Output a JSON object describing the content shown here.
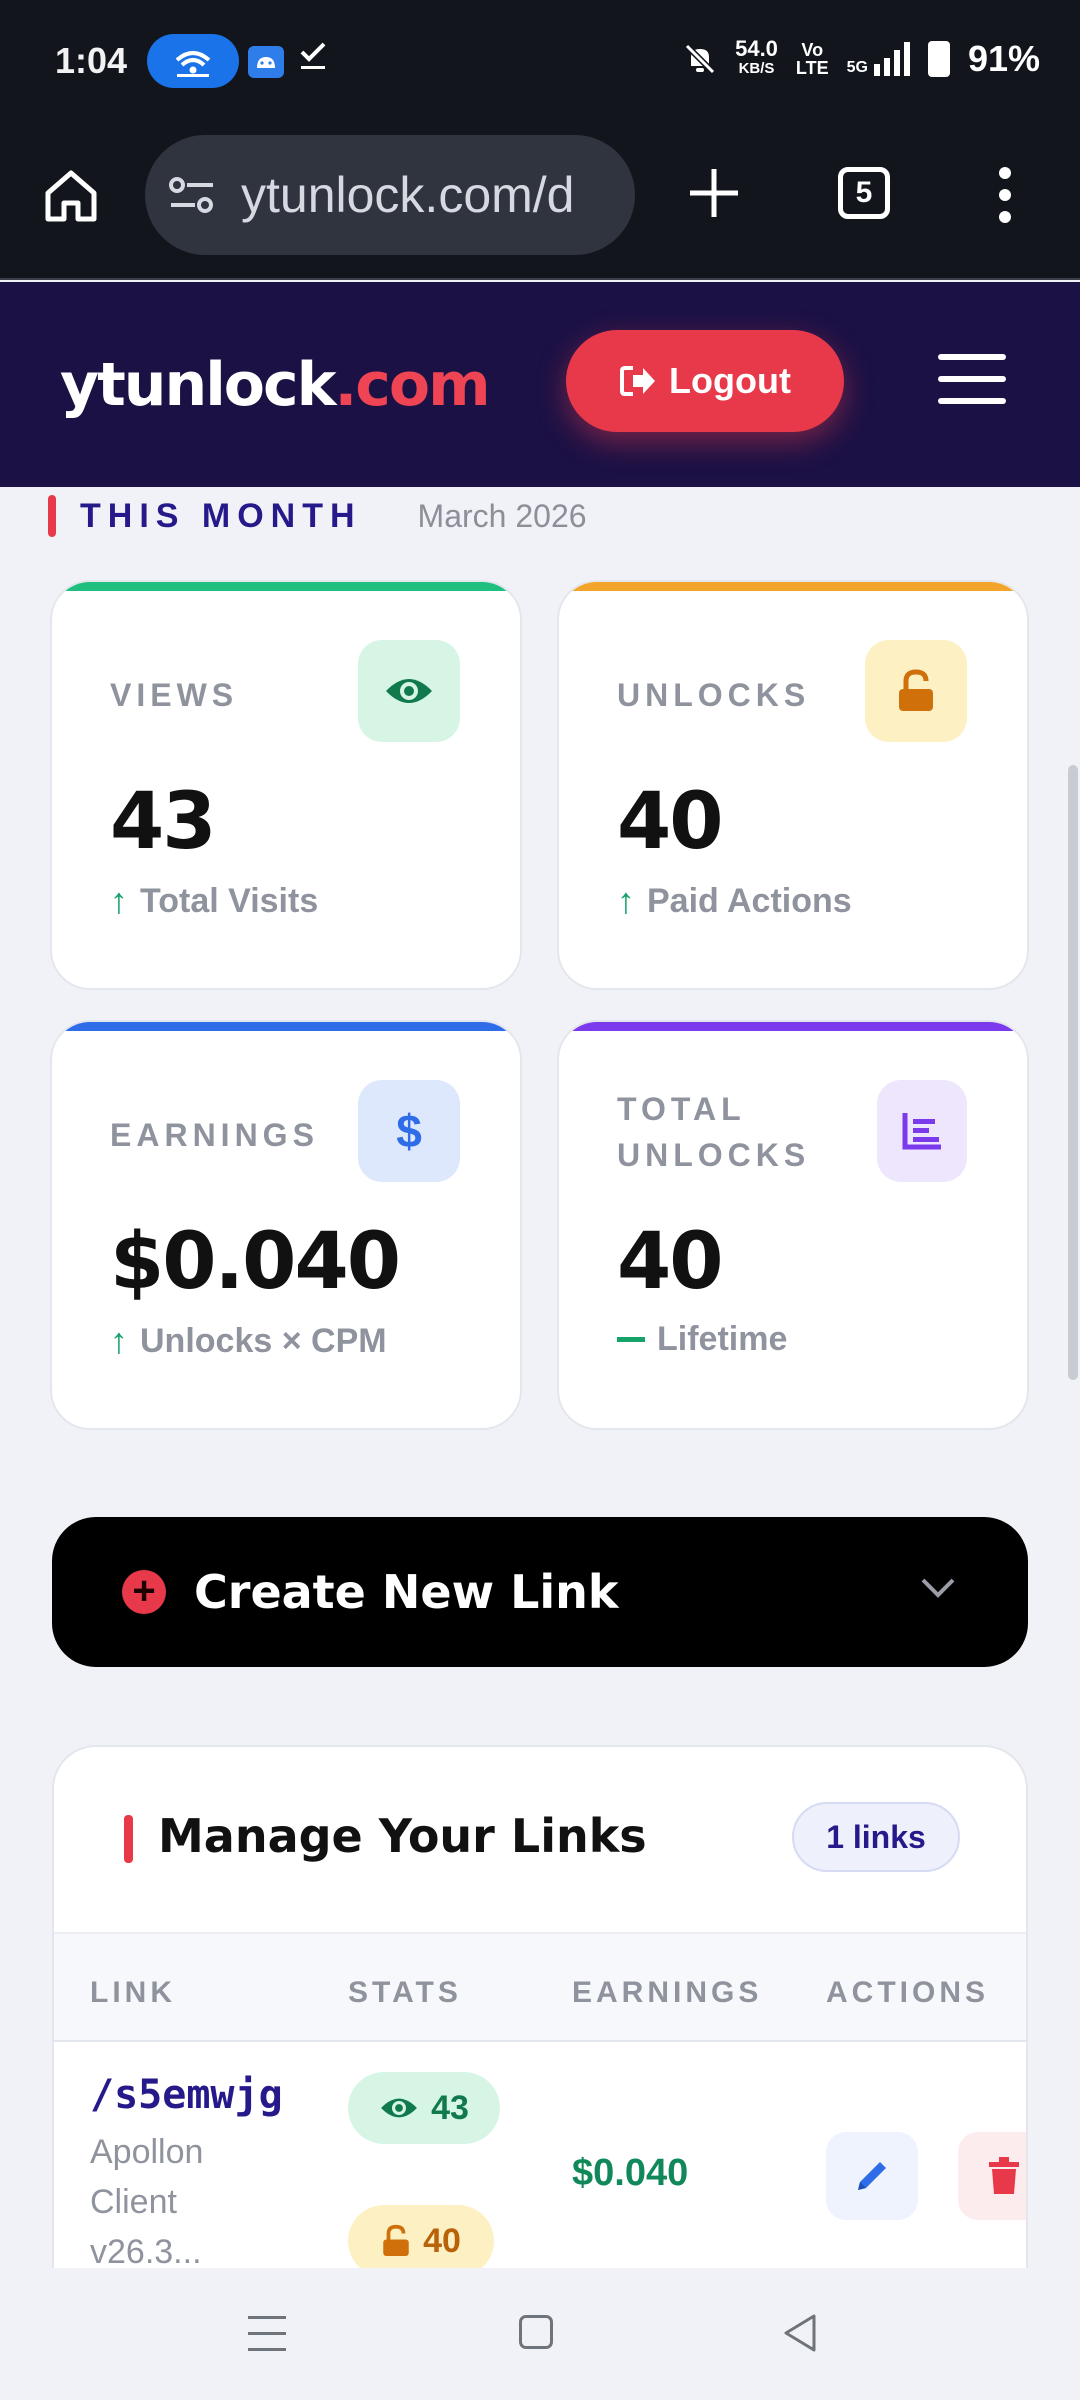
{
  "status_bar": {
    "time": "1:04",
    "net_speed": "54.0",
    "net_unit": "KB/S",
    "volte_top": "Vo",
    "volte_bottom": "LTE",
    "network": "5G",
    "battery": "91%"
  },
  "browser": {
    "url": "ytunlock.com/d",
    "tab_count": "5"
  },
  "header": {
    "logo_main": "ytunlock",
    "logo_accent": ".com",
    "logout_label": "Logout"
  },
  "this_month": {
    "label": "THIS MONTH",
    "date": "March 2026"
  },
  "stats": {
    "views": {
      "label": "VIEWS",
      "value": "43",
      "sub": "Total Visits",
      "accent": "#1fbf7f"
    },
    "unlocks": {
      "label": "UNLOCKS",
      "value": "40",
      "sub": "Paid Actions",
      "accent": "#f2a52a"
    },
    "earnings": {
      "label": "EARNINGS",
      "value": "$0.040",
      "sub": "Unlocks × CPM",
      "accent": "#2f6de8"
    },
    "total_unlocks": {
      "label": "TOTAL UNLOCKS",
      "value": "40",
      "sub": "Lifetime",
      "accent": "#7c3aed"
    }
  },
  "create_link": {
    "label": "Create New Link"
  },
  "manage_links": {
    "title": "Manage Your Links",
    "count_badge": "1 links",
    "columns": [
      "LINK",
      "STATS",
      "EARNINGS",
      "ACTIONS"
    ],
    "rows": [
      {
        "slug": "/s5emwjg",
        "description": "Apollon Client v26.3...",
        "views": "43",
        "unlocks": "40",
        "earnings": "$0.040"
      }
    ]
  }
}
